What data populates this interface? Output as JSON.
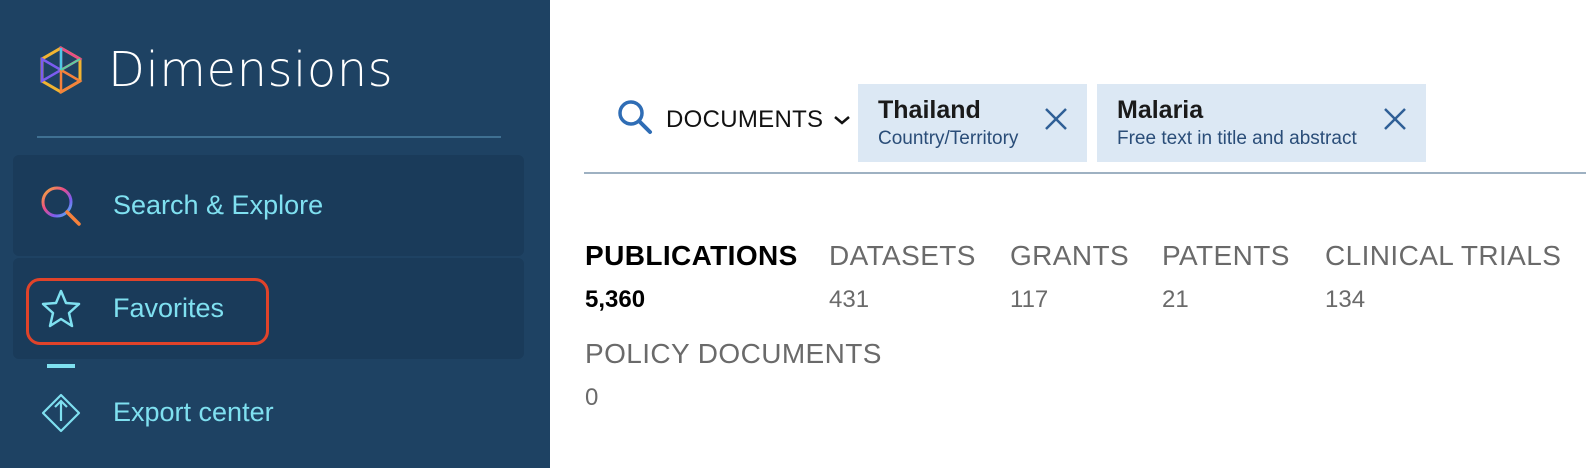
{
  "sidebar": {
    "brand": {
      "name": "Dimensions",
      "logo_icon": "dimensions-logo-icon"
    },
    "items": [
      {
        "label": "Search & Explore",
        "icon": "search-icon"
      },
      {
        "label": "Favorites",
        "icon": "star-icon"
      },
      {
        "label": "Export center",
        "icon": "export-icon"
      }
    ]
  },
  "search": {
    "icon": "search-icon",
    "scope": "DOCUMENTS",
    "filters": [
      {
        "title": "Thailand",
        "subtitle": "Country/Territory"
      },
      {
        "title": "Malaria",
        "subtitle": "Free text in title and abstract"
      }
    ]
  },
  "tabs": [
    {
      "label": "PUBLICATIONS",
      "count": "5,360",
      "active": true
    },
    {
      "label": "DATASETS",
      "count": "431"
    },
    {
      "label": "GRANTS",
      "count": "117"
    },
    {
      "label": "PATENTS",
      "count": "21"
    },
    {
      "label": "CLINICAL TRIALS",
      "count": "134"
    },
    {
      "label": "POLICY DOCUMENTS",
      "count": "0"
    }
  ],
  "colors": {
    "sidebar_bg": "#1e4263",
    "nav_item_bg": "#1a3b5a",
    "nav_text": "#7fe0f0",
    "highlight": "#e0432a",
    "chip_bg": "#dce8f4",
    "accent_blue": "#2f6db5"
  }
}
